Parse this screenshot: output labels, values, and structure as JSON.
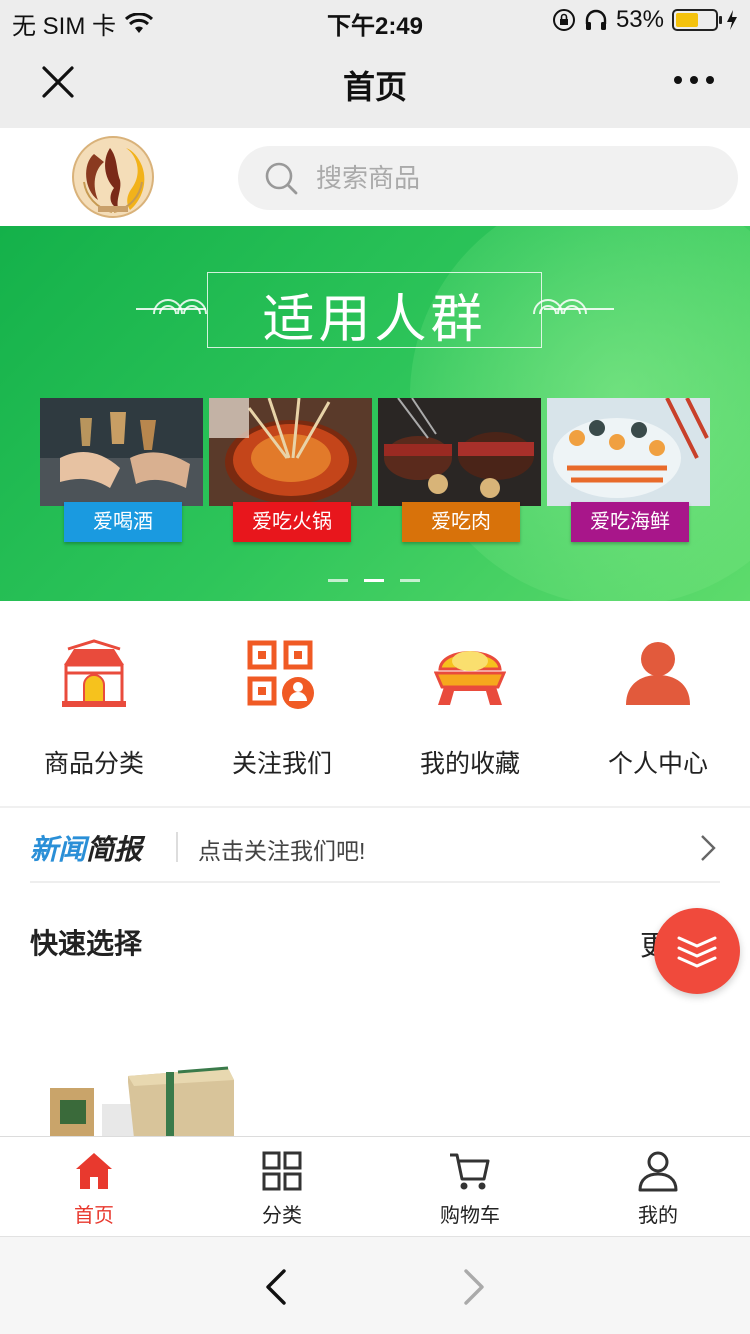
{
  "status_bar": {
    "carrier": "无 SIM 卡",
    "time": "下午2:49",
    "battery": "53%",
    "battery_level": 0.53
  },
  "navbar": {
    "title": "首页",
    "close_icon": "close-icon",
    "more_icon": "more-icon"
  },
  "search": {
    "placeholder": "搜索商品"
  },
  "banner": {
    "title": "适用人群",
    "cards": [
      {
        "label": "爱喝酒",
        "color": "#1a9ae0"
      },
      {
        "label": "爱吃火锅",
        "color": "#e8161c"
      },
      {
        "label": "爱吃肉",
        "color": "#d8720a"
      },
      {
        "label": "爱吃海鲜",
        "color": "#a8168a"
      }
    ],
    "active_slide": 1,
    "slide_count": 3
  },
  "quick_nav": [
    {
      "label": "商品分类",
      "icon": "store-icon"
    },
    {
      "label": "关注我们",
      "icon": "qrcode-icon"
    },
    {
      "label": "我的收藏",
      "icon": "gold-ingot-icon"
    },
    {
      "label": "个人中心",
      "icon": "person-icon"
    }
  ],
  "news": {
    "brand_part1": "新闻",
    "brand_part2": "简报",
    "text": "点击关注我们吧!"
  },
  "quick_select": {
    "title": "快速选择",
    "more": "更"
  },
  "tabbar": [
    {
      "label": "首页",
      "icon": "home-icon",
      "active": true
    },
    {
      "label": "分类",
      "icon": "grid-icon",
      "active": false
    },
    {
      "label": "购物车",
      "icon": "cart-icon",
      "active": false
    },
    {
      "label": "我的",
      "icon": "user-icon",
      "active": false
    }
  ],
  "colors": {
    "accent": "#e8392e",
    "banner_green": "#22bb52"
  }
}
